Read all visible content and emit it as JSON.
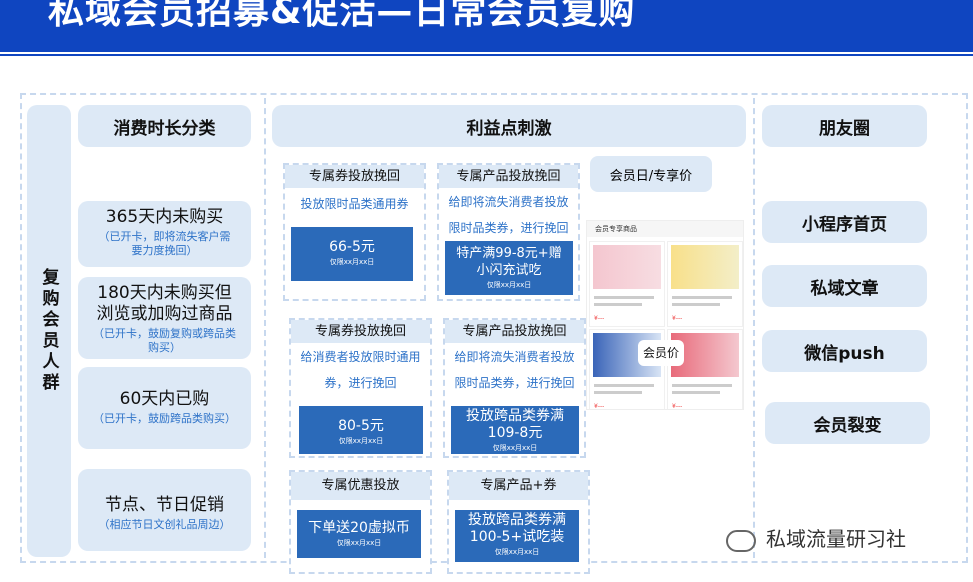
{
  "page": {
    "title": "私域会员招募&促活—日常会员复购"
  },
  "crowd_label": "复购会员人群",
  "category_header": "消费时长分类",
  "categories": [
    {
      "title": "365天内未购买",
      "sub": "（已开卡，即将流失客户需要力度挽回）"
    },
    {
      "title": "180天内未购买但浏览或加购过商品",
      "sub": "（已开卡，鼓励复购或跨品类购买）"
    },
    {
      "title": "60天内已购",
      "sub": "（已开卡，鼓励跨品类购买）"
    },
    {
      "title": "节点、节日促销",
      "sub": "（相应节日文创礼品周边）"
    }
  ],
  "benefit_header": "利益点刺激",
  "cards": [
    {
      "head": "专属券投放挽回",
      "desc": "投放限时品类通用券",
      "coupon": "66-5元",
      "valid": "仅限xx月xx日"
    },
    {
      "head": "专属产品投放挽回",
      "desc": "给即将流失消费者投放限时品类券，进行挽回",
      "coupon": "特产满99-8元+赠小闪充试吃",
      "valid": "仅限xx月xx日"
    },
    {
      "head": "专属券投放挽回",
      "desc": "给消费者投放限时通用券，进行挽回",
      "coupon": "80-5元",
      "valid": "仅限xx月xx日"
    },
    {
      "head": "专属产品投放挽回",
      "desc": "给即将流失消费者投放限时品类券，进行挽回",
      "coupon": "投放跨品类券满109-8元",
      "valid": "仅限xx月xx日"
    },
    {
      "head": "专属优惠投放",
      "desc": "",
      "coupon": "下单送20虚拟币",
      "valid": "仅限xx月xx日"
    },
    {
      "head": "专属产品+券",
      "desc": "",
      "coupon": "投放跨品类券满100-5+试吃装",
      "valid": "仅限xx月xx日"
    }
  ],
  "member_day": "会员日/专享价",
  "shop": {
    "bar": "会员专享商品",
    "tag": "会员价"
  },
  "channels": [
    "朋友圈",
    "小程序首页",
    "私域文章",
    "微信push",
    "会员裂变"
  ],
  "watermark": "私域流量研习社",
  "colors": {
    "brand": "#0f45c0",
    "pill": "#dde9f6",
    "coupon": "#2b6ab9",
    "subtext": "#2d72c8"
  }
}
